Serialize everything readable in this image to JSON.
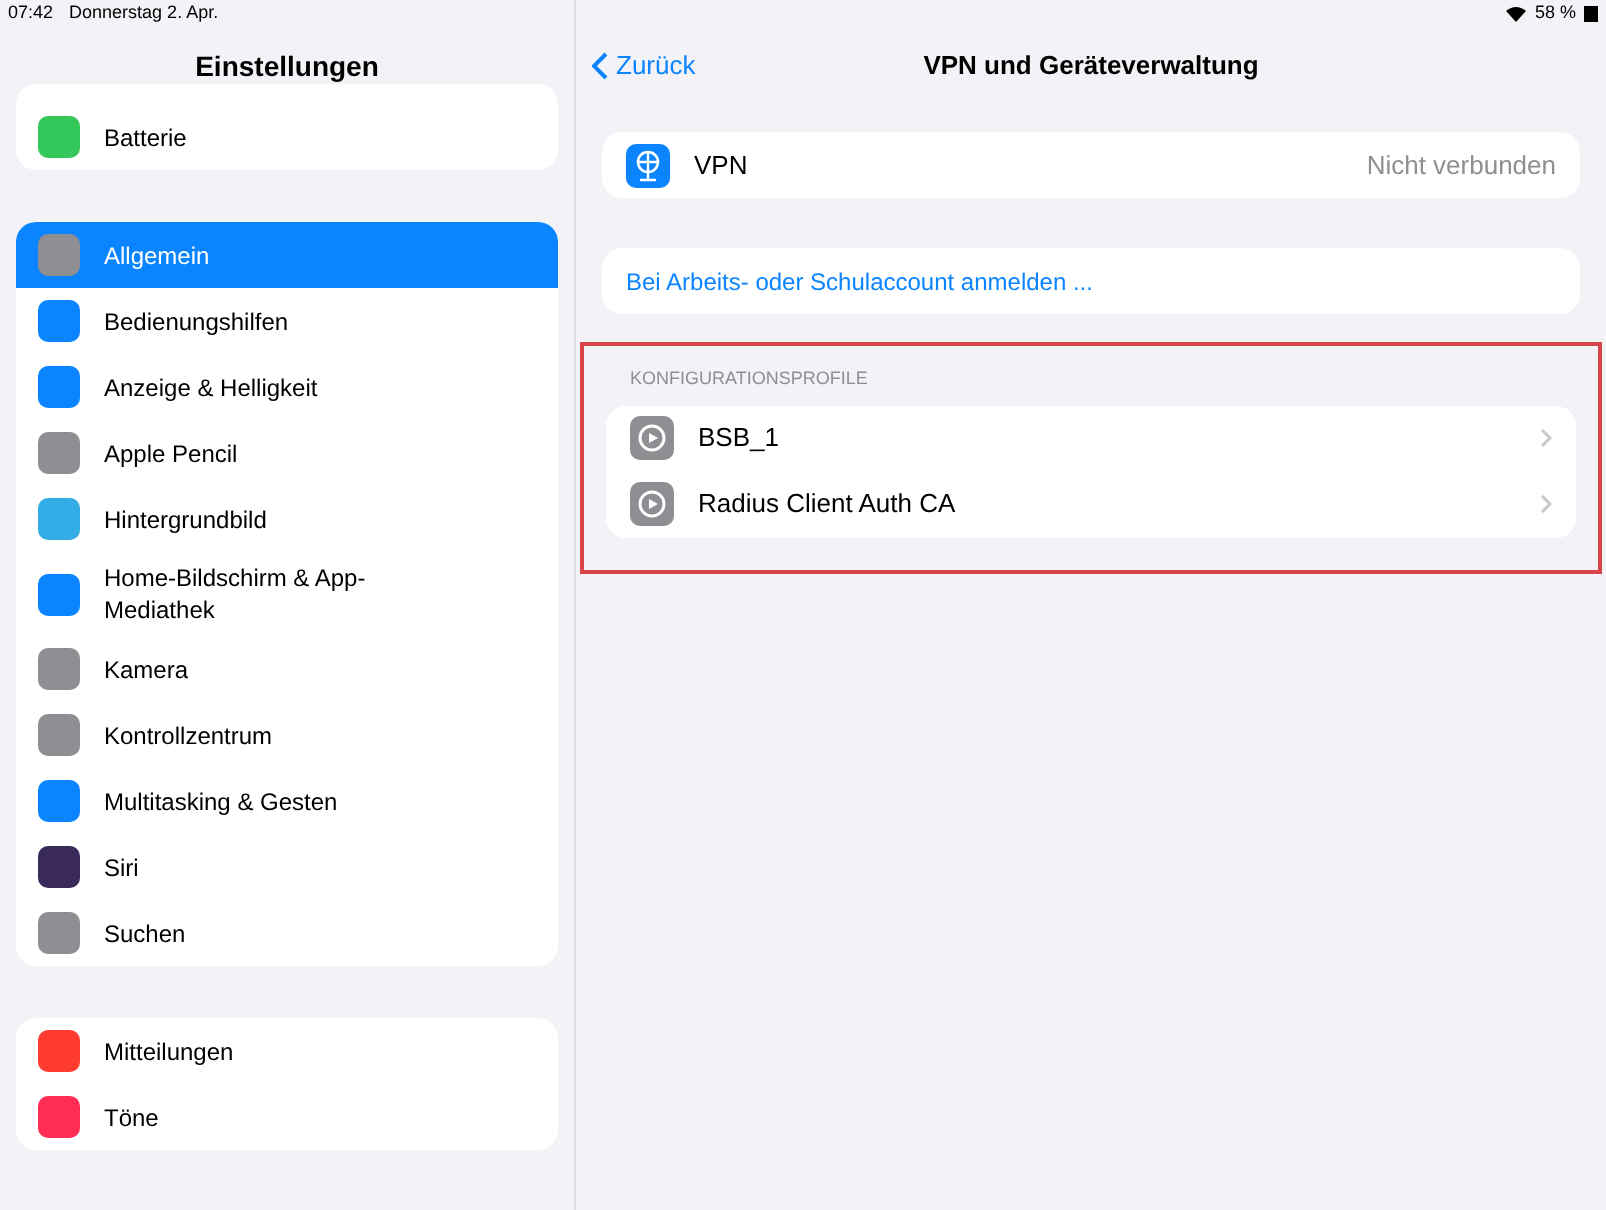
{
  "status_bar": {
    "time": "07:42",
    "date": "Donnerstag 2. Apr.",
    "battery": "58 %"
  },
  "sidebar": {
    "title": "Einstellungen",
    "groups": [
      {
        "items": [
          {
            "label": "Batterie",
            "color": "#34c759",
            "selected": false
          }
        ]
      },
      {
        "items": [
          {
            "label": "Allgemein",
            "color": "#8e8e93",
            "selected": true
          },
          {
            "label": "Bedienungshilfen",
            "color": "#0a84ff",
            "selected": false
          },
          {
            "label": "Anzeige & Helligkeit",
            "color": "#0a84ff",
            "selected": false
          },
          {
            "label": "Apple Pencil",
            "color": "#8e8e93",
            "selected": false
          },
          {
            "label": "Hintergrundbild",
            "color": "#32ade6",
            "selected": false
          },
          {
            "label": "Home-Bildschirm & App-Mediathek",
            "color": "#0a84ff",
            "selected": false
          },
          {
            "label": "Kamera",
            "color": "#8e8e93",
            "selected": false
          },
          {
            "label": "Kontrollzentrum",
            "color": "#8e8e93",
            "selected": false
          },
          {
            "label": "Multitasking & Gesten",
            "color": "#0a84ff",
            "selected": false
          },
          {
            "label": "Siri",
            "color": "#3a2a5a",
            "selected": false
          },
          {
            "label": "Suchen",
            "color": "#8e8e93",
            "selected": false
          }
        ]
      },
      {
        "items": [
          {
            "label": "Mitteilungen",
            "color": "#ff3b30",
            "selected": false
          },
          {
            "label": "Töne",
            "color": "#ff2d55",
            "selected": false
          }
        ]
      }
    ]
  },
  "detail": {
    "back": "Zurück",
    "title": "VPN und Geräteverwaltung",
    "vpn": {
      "label": "VPN",
      "value": "Nicht verbunden"
    },
    "sign_in": "Bei Arbeits- oder Schulaccount anmelden ...",
    "profiles": {
      "header": "KONFIGURATIONSPROFILE",
      "items": [
        "BSB_1",
        "Radius Client Auth CA"
      ],
      "highlighted": true
    }
  }
}
